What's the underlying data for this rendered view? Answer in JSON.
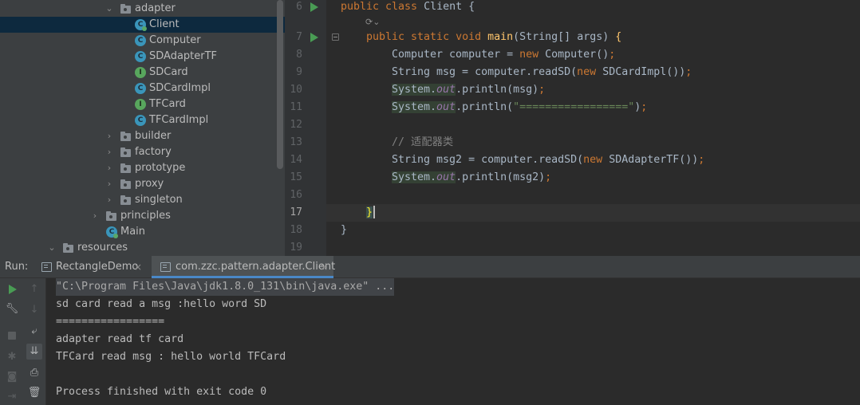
{
  "project_tree": {
    "items": [
      {
        "label": "adapter",
        "kind": "folder",
        "expanded": true
      },
      {
        "label": "Client",
        "kind": "class-runnable",
        "selected": true
      },
      {
        "label": "Computer",
        "kind": "class"
      },
      {
        "label": "SDAdapterTF",
        "kind": "class"
      },
      {
        "label": "SDCard",
        "kind": "interface"
      },
      {
        "label": "SDCardImpl",
        "kind": "class"
      },
      {
        "label": "TFCard",
        "kind": "interface"
      },
      {
        "label": "TFCardImpl",
        "kind": "class"
      },
      {
        "label": "builder",
        "kind": "folder"
      },
      {
        "label": "factory",
        "kind": "folder"
      },
      {
        "label": "prototype",
        "kind": "folder"
      },
      {
        "label": "proxy",
        "kind": "folder"
      },
      {
        "label": "singleton",
        "kind": "folder"
      },
      {
        "label": "principles",
        "kind": "folder"
      },
      {
        "label": "Main",
        "kind": "class-runnable"
      },
      {
        "label": "resources",
        "kind": "resources-folder",
        "expanded": true
      }
    ],
    "icon_letters": {
      "class": "C",
      "interface": "I"
    }
  },
  "editor": {
    "line_numbers": [
      "6",
      "7",
      "8",
      "9",
      "10",
      "11",
      "12",
      "13",
      "14",
      "15",
      "16",
      "17",
      "18",
      "19"
    ],
    "current_line": "17",
    "code": {
      "l6_kw": "public class ",
      "l6_rest": "Client {",
      "l7_kw1": "public static void ",
      "l7_fn": "main",
      "l7_rest": "(String[] args) ",
      "l7_brace": "{",
      "l8_a": "Computer computer = ",
      "l8_kw": "new ",
      "l8_b": "Computer()",
      "l8_semi": ";",
      "l9_a": "String msg = computer.readSD(",
      "l9_kw": "new ",
      "l9_b": "SDCardImpl())",
      "l9_semi": ";",
      "l10_sys": "System.",
      "l10_out": "out",
      "l10_rest": ".println(msg)",
      "l10_semi": ";",
      "l11_sys": "System.",
      "l11_out": "out",
      "l11_a": ".println(",
      "l11_str": "\"=================\"",
      "l11_b": ")",
      "l11_semi": ";",
      "l13_comment": "// 适配器类",
      "l14_a": "String msg2 = computer.readSD(",
      "l14_kw": "new ",
      "l14_b": "SDAdapterTF())",
      "l14_semi": ";",
      "l15_sys": "System.",
      "l15_out": "out",
      "l15_rest": ".println(msg2)",
      "l15_semi": ";",
      "l17_brace": "}",
      "l18_brace": "}"
    }
  },
  "run_panel": {
    "label": "Run:",
    "tabs": [
      {
        "label": "RectangleDemo",
        "active": false
      },
      {
        "label": "com.zzc.pattern.adapter.Client",
        "active": true
      }
    ],
    "close_glyph": "×",
    "console_lines": [
      "\"C:\\Program Files\\Java\\jdk1.8.0_131\\bin\\java.exe\" ...",
      "sd card read a msg :hello word SD",
      "=================",
      "adapter read tf card",
      "TFCard read msg : hello world TFCard",
      "",
      "Process finished with exit code 0"
    ]
  },
  "colors": {
    "keyword": "#cc7832",
    "function": "#ffc66d",
    "string": "#6a8759",
    "comment": "#808080",
    "static_field": "#9876aa",
    "run_green": "#499c54"
  }
}
